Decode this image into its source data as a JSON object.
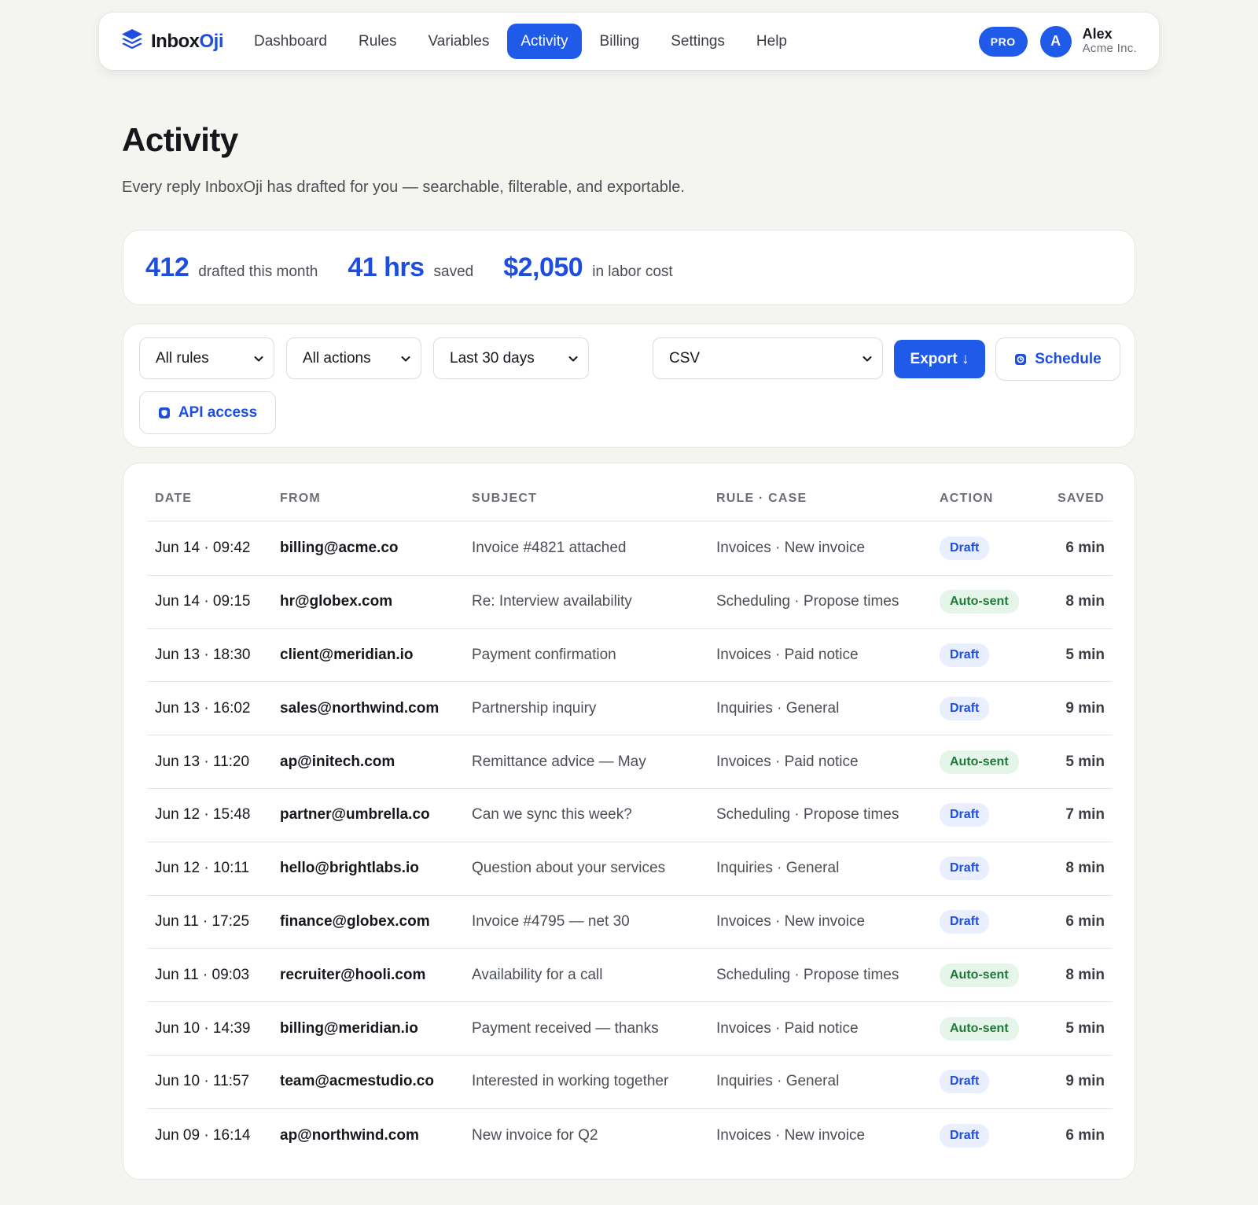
{
  "nav": {
    "brand_prefix": "Inbox",
    "brand_suffix": "Oji",
    "links": [
      "Dashboard",
      "Rules",
      "Variables",
      "Activity",
      "Billing",
      "Settings",
      "Help"
    ],
    "active": "Activity",
    "plan_badge": "PRO",
    "user": {
      "initial": "A",
      "name": "Alex",
      "org": "Acme Inc."
    }
  },
  "header": {
    "title": "Activity",
    "subtitle": "Every reply InboxOji has drafted for you — searchable, filterable, and exportable."
  },
  "stats": [
    {
      "value": "412",
      "label": "drafted this month"
    },
    {
      "value": "41 hrs",
      "label": "saved"
    },
    {
      "value": "$2,050",
      "label": "in labor cost"
    }
  ],
  "filters": {
    "rules": "All rules",
    "actions": "All actions",
    "period": "Last 30 days",
    "format": "CSV",
    "export_label": "Export ↓",
    "schedule_label": "Schedule",
    "api_label": "API access"
  },
  "table": {
    "columns": [
      "DATE",
      "FROM",
      "SUBJECT",
      "RULE · CASE",
      "ACTION",
      "SAVED"
    ],
    "rows": [
      {
        "date": "Jun 14 · 09:42",
        "from": "billing@acme.co",
        "subject": "Invoice #4821 attached",
        "rule": "Invoices · New invoice",
        "action": "Draft",
        "saved": "6 min"
      },
      {
        "date": "Jun 14 · 09:15",
        "from": "hr@globex.com",
        "subject": "Re: Interview availability",
        "rule": "Scheduling · Propose times",
        "action": "Auto-sent",
        "saved": "8 min"
      },
      {
        "date": "Jun 13 · 18:30",
        "from": "client@meridian.io",
        "subject": "Payment confirmation",
        "rule": "Invoices · Paid notice",
        "action": "Draft",
        "saved": "5 min"
      },
      {
        "date": "Jun 13 · 16:02",
        "from": "sales@northwind.com",
        "subject": "Partnership inquiry",
        "rule": "Inquiries · General",
        "action": "Draft",
        "saved": "9 min"
      },
      {
        "date": "Jun 13 · 11:20",
        "from": "ap@initech.com",
        "subject": "Remittance advice — May",
        "rule": "Invoices · Paid notice",
        "action": "Auto-sent",
        "saved": "5 min"
      },
      {
        "date": "Jun 12 · 15:48",
        "from": "partner@umbrella.co",
        "subject": "Can we sync this week?",
        "rule": "Scheduling · Propose times",
        "action": "Draft",
        "saved": "7 min"
      },
      {
        "date": "Jun 12 · 10:11",
        "from": "hello@brightlabs.io",
        "subject": "Question about your services",
        "rule": "Inquiries · General",
        "action": "Draft",
        "saved": "8 min"
      },
      {
        "date": "Jun 11 · 17:25",
        "from": "finance@globex.com",
        "subject": "Invoice #4795 — net 30",
        "rule": "Invoices · New invoice",
        "action": "Draft",
        "saved": "6 min"
      },
      {
        "date": "Jun 11 · 09:03",
        "from": "recruiter@hooli.com",
        "subject": "Availability for a call",
        "rule": "Scheduling · Propose times",
        "action": "Auto-sent",
        "saved": "8 min"
      },
      {
        "date": "Jun 10 · 14:39",
        "from": "billing@meridian.io",
        "subject": "Payment received — thanks",
        "rule": "Invoices · Paid notice",
        "action": "Auto-sent",
        "saved": "5 min"
      },
      {
        "date": "Jun 10 · 11:57",
        "from": "team@acmestudio.co",
        "subject": "Interested in working together",
        "rule": "Inquiries · General",
        "action": "Draft",
        "saved": "9 min"
      },
      {
        "date": "Jun 09 · 16:14",
        "from": "ap@northwind.com",
        "subject": "New invoice for Q2",
        "rule": "Invoices · New invoice",
        "action": "Draft",
        "saved": "6 min"
      }
    ]
  },
  "colors": {
    "accent": "#1f5ae8",
    "draft_bg": "#e9efff",
    "autosent_bg": "#e5f5ea",
    "autosent_text": "#1e7a36"
  }
}
